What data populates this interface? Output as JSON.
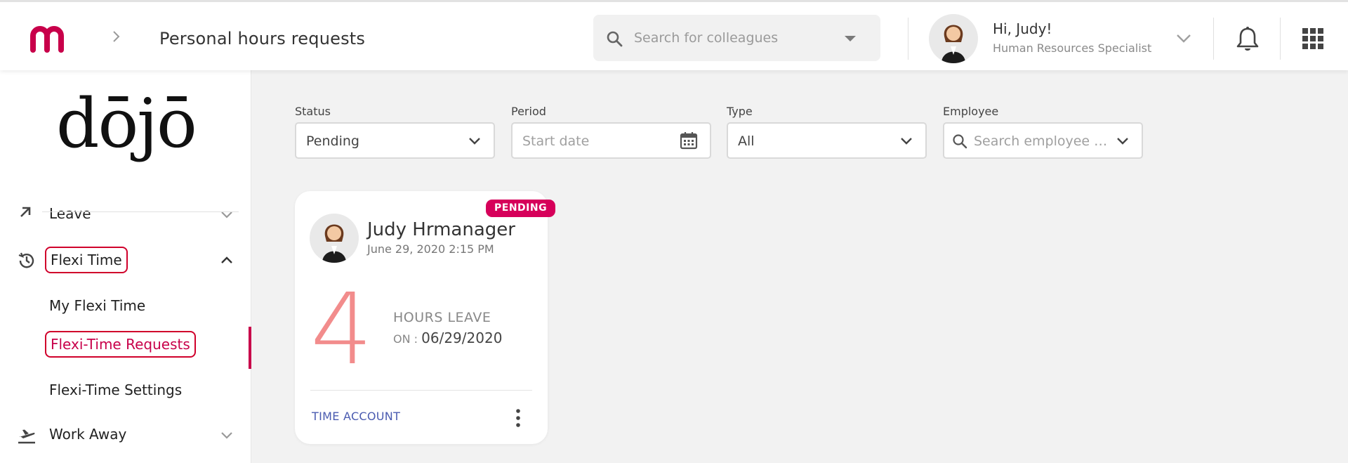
{
  "header": {
    "page_title": "Personal hours requests",
    "search": {
      "placeholder": "Search for colleagues"
    },
    "user": {
      "greeting": "Hi, Judy!",
      "role": "Human Resources Specialist"
    }
  },
  "sidebar": {
    "brand": "dōjō",
    "items": [
      {
        "label": "Leave",
        "icon": "leave-icon",
        "expanded": false
      },
      {
        "label": "Flexi Time",
        "icon": "history-icon",
        "expanded": true,
        "children": [
          {
            "label": "My Flexi Time"
          },
          {
            "label": "Flexi-Time Requests",
            "active": true
          },
          {
            "label": "Flexi-Time Settings"
          }
        ]
      },
      {
        "label": "Work Away",
        "icon": "airplane-icon",
        "expanded": false
      }
    ]
  },
  "filters": {
    "status": {
      "label": "Status",
      "value": "Pending"
    },
    "period": {
      "label": "Period",
      "placeholder": "Start date"
    },
    "type": {
      "label": "Type",
      "value": "All"
    },
    "employee": {
      "label": "Employee",
      "placeholder": "Search employee na..."
    }
  },
  "requests": [
    {
      "badge": "PENDING",
      "name": "Judy Hrmanager",
      "created": "June 29, 2020 2:15 PM",
      "hours": "4",
      "kind": "HOURS LEAVE",
      "on_label": "ON :",
      "on_date": "06/29/2020",
      "action": "TIME ACCOUNT"
    }
  ],
  "colors": {
    "accent": "#c8004a",
    "badge": "#d6005a",
    "hours_number": "#f28c8c",
    "link": "#4a5bb0",
    "highlight_box": "#d0002b"
  }
}
